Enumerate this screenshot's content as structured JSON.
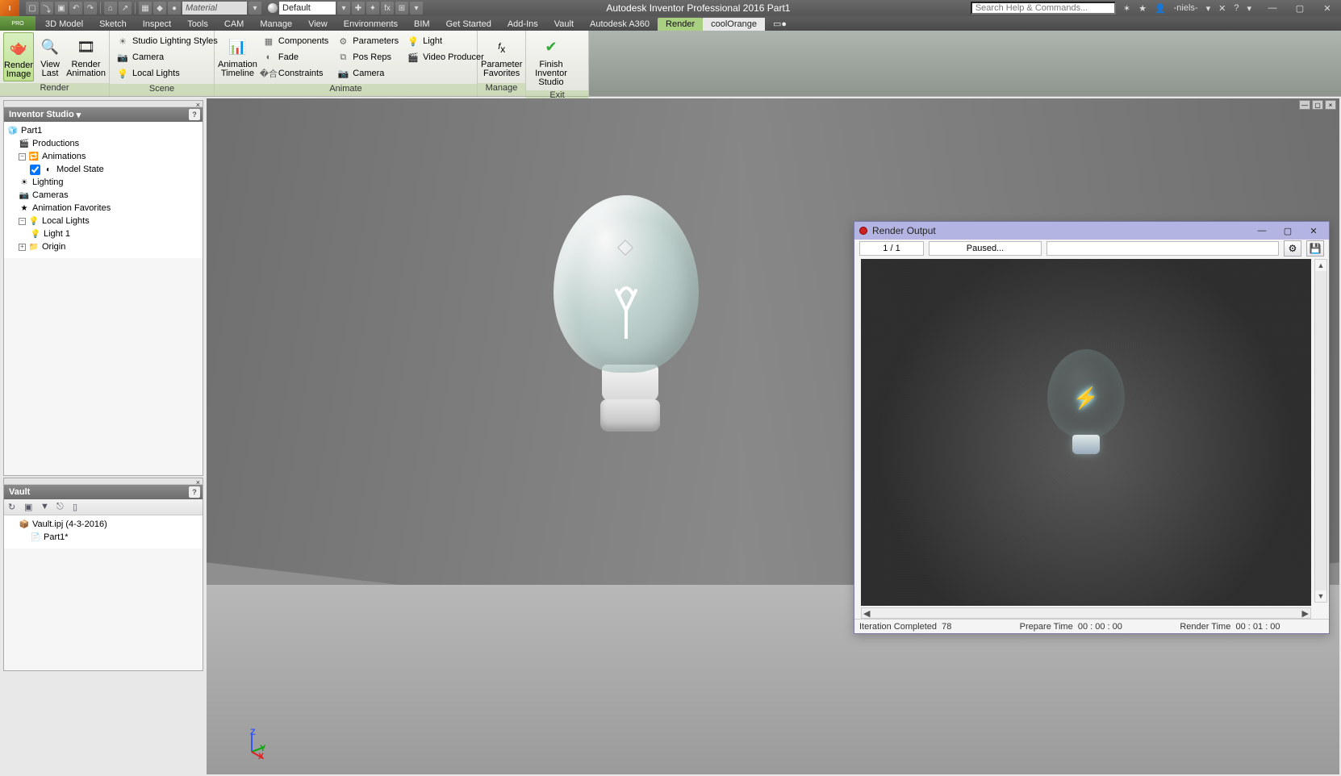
{
  "app": {
    "title": "Autodesk Inventor Professional 2016   Part1"
  },
  "qat": {
    "material_label": "Material",
    "appearance_label": "Default"
  },
  "search": {
    "placeholder": "Search Help & Commands..."
  },
  "user": {
    "name": "-niels-"
  },
  "tabs": {
    "items": [
      "3D Model",
      "Sketch",
      "Inspect",
      "Tools",
      "CAM",
      "Manage",
      "View",
      "Environments",
      "BIM",
      "Get Started",
      "Add-Ins",
      "Vault",
      "Autodesk A360",
      "Render",
      "coolOrange"
    ],
    "active": "Render"
  },
  "ribbon": {
    "groups": {
      "render": {
        "label": "Render",
        "render_image": "Render Image",
        "view_last": "View Last",
        "render_animation": "Render Animation"
      },
      "scene": {
        "label": "Scene",
        "studio_lighting": "Studio Lighting Styles",
        "camera": "Camera",
        "local_lights": "Local Lights"
      },
      "animate": {
        "label": "Animate",
        "animation_timeline": "Animation Timeline",
        "components": "Components",
        "fade": "Fade",
        "constraints": "Constraints",
        "parameters": "Parameters",
        "pos_reps": "Pos Reps",
        "camera2": "Camera",
        "light": "Light",
        "video_producer": "Video Producer"
      },
      "manage": {
        "label": "Manage",
        "param_fav": "Parameter Favorites"
      },
      "exit": {
        "label": "Exit",
        "finish": "Finish Inventor Studio"
      }
    }
  },
  "panels": {
    "studio": {
      "title": "Inventor Studio",
      "root": "Part1",
      "productions": "Productions",
      "animations": "Animations",
      "model_state": "Model State",
      "lighting": "Lighting",
      "cameras": "Cameras",
      "anim_fav": "Animation Favorites",
      "local_lights": "Local Lights",
      "light1": "Light 1",
      "origin": "Origin"
    },
    "vault": {
      "title": "Vault",
      "proj": "Vault.ipj (4-3-2016)",
      "part": "Part1*"
    }
  },
  "axes": {
    "x": "X",
    "y": "Y",
    "z": "Z"
  },
  "render_window": {
    "title": "Render Output",
    "frame": "1 / 1",
    "state": "Paused...",
    "iteration_label": "Iteration Completed",
    "iteration_val": "78",
    "prepare_label": "Prepare Time",
    "prepare_val": "00 : 00 : 00",
    "render_label": "Render Time",
    "render_val": "00 : 01 : 00"
  }
}
